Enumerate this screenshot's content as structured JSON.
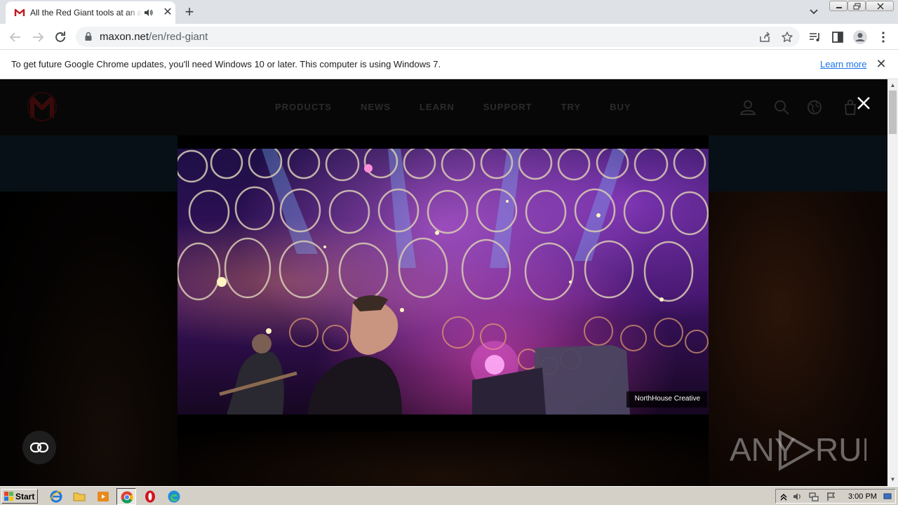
{
  "browser": {
    "tab_title": "All the Red Giant tools at an affordable price",
    "new_tab": "+",
    "tab_close": "✕",
    "url_host": "maxon.net",
    "url_path": "/en/red-giant"
  },
  "infobar": {
    "message": "To get future Google Chrome updates, you'll need Windows 10 or later. This computer is using Windows 7.",
    "link": "Learn more",
    "close": "✕"
  },
  "site": {
    "nav": [
      "PRODUCTS",
      "NEWS",
      "LEARN",
      "SUPPORT",
      "TRY",
      "BUY"
    ]
  },
  "video": {
    "credit": "NorthHouse Creative"
  },
  "watermark": {
    "left": "ANY",
    "right": "RUN"
  },
  "taskbar": {
    "start": "Start",
    "clock": "3:00 PM"
  },
  "colors": {
    "brand_red": "#c4161c",
    "link_blue": "#1a73e8",
    "taskbar": "#d4d0c8"
  }
}
